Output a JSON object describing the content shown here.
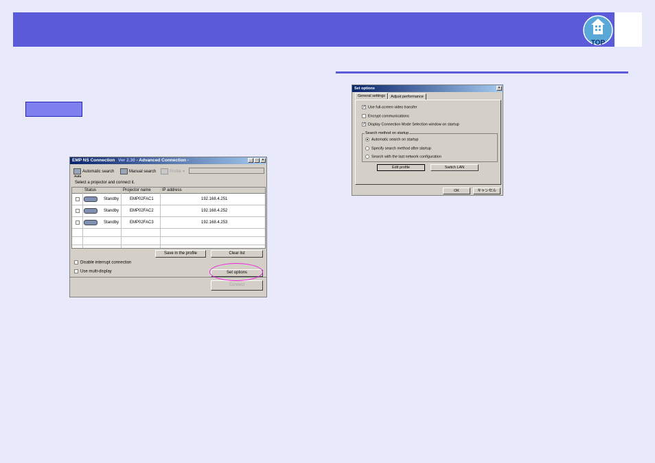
{
  "header": {
    "logo_label": "TOP"
  },
  "emp_window": {
    "title": "EMP NS Connection",
    "version": "Ver 2.30",
    "mode": " - Advanced Connection - ",
    "toolbar": {
      "auto_label": "Auto",
      "automatic_search": "Automatic search",
      "manual_search": "Manual search",
      "profile": "Profile"
    },
    "instruction": "Select a projector and connect it.",
    "columns": [
      "Status",
      "Projector name",
      "IP address"
    ],
    "rows": [
      {
        "status": "Standby",
        "name": "EMP02FAC1",
        "ip": "192.168.4.251"
      },
      {
        "status": "Standby",
        "name": "EMP02FAC2",
        "ip": "192.168.4.252"
      },
      {
        "status": "Standby",
        "name": "EMP02FAC3",
        "ip": "192.168.4.253"
      }
    ],
    "save_profile": "Save in the profile",
    "clear_list": "Clear list",
    "disable_interrupt": "Disable interrupt connection",
    "use_multi_display": "Use multi-display",
    "set_options": "Set options",
    "connect": "Connect"
  },
  "set_options_window": {
    "title": "Set options",
    "tabs": [
      "General settings",
      "Adjust performance"
    ],
    "opt_fullscreen": "Use full-screen video transfer",
    "opt_encrypt": "Encrypt communications",
    "opt_display_mode": "Display Connection Mode Selection window on startup",
    "group_title": "Search method on startup",
    "radio_auto": "Automatic search on startup",
    "radio_specify": "Specify search method after startup",
    "radio_last": "Search with the last network configuration",
    "edit_profile": "Edit profile",
    "switch_lan": "Switch LAN",
    "ok": "OK",
    "cancel": "キャンセル"
  },
  "colors": {
    "banner": "#5b5bd9",
    "page_bg": "#e8e9fb",
    "highlight": "#ee22dd"
  }
}
